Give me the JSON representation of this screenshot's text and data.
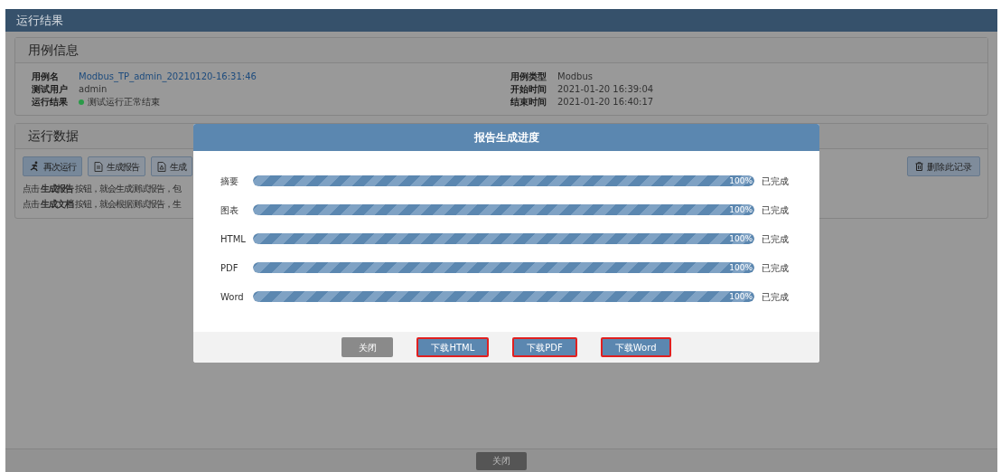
{
  "page_title": "运行结果",
  "case_info": {
    "title": "用例信息",
    "left_fields": [
      {
        "label": "用例名",
        "value": "Modbus_TP_admin_20210120-16:31:46",
        "kind": "link"
      },
      {
        "label": "测试用户",
        "value": "admin",
        "kind": "text"
      },
      {
        "label": "运行结果",
        "value": "测试运行正常结束",
        "kind": "status",
        "color": "#2a9a48"
      }
    ],
    "right_fields": [
      {
        "label": "用例类型",
        "value": "Modbus",
        "kind": "text"
      },
      {
        "label": "开始时间",
        "value": "2021-01-20 16:39:04",
        "kind": "text"
      },
      {
        "label": "结束时间",
        "value": "2021-01-20 16:40:17",
        "kind": "text"
      }
    ]
  },
  "run_data": {
    "title": "运行数据",
    "buttons": [
      {
        "label": "再次运行",
        "kind": "run"
      },
      {
        "label": "生成报告",
        "kind": "report"
      },
      {
        "label": "生成",
        "kind": "pdf"
      }
    ],
    "delete_button": "删除此记录",
    "hints": [
      "点击 **生成报告** 按钮，就会生成测试报告，包",
      "点击 **生成文档** 按钮，就会根据测试报告，生"
    ]
  },
  "footer_button": "关闭",
  "dialog": {
    "title": "报告生成进度",
    "rows": [
      {
        "label": "摘要",
        "level": 1,
        "reading": "100%",
        "status": "已完成"
      },
      {
        "label": "图表",
        "level": 1,
        "reading": "100%",
        "status": "已完成"
      },
      {
        "label": "HTML",
        "level": 1,
        "reading": "100%",
        "status": "已完成"
      },
      {
        "label": "PDF",
        "level": 1,
        "reading": "100%",
        "status": "已完成"
      },
      {
        "label": "Word",
        "level": 1,
        "reading": "100%",
        "status": "已完成"
      }
    ],
    "buttons": [
      {
        "label": "关闭",
        "kind": "secondary",
        "highlighted": false
      },
      {
        "label": "下载HTML",
        "kind": "primary",
        "highlighted": true
      },
      {
        "label": "下载PDF",
        "kind": "primary",
        "highlighted": true
      },
      {
        "label": "下载Word",
        "kind": "primary",
        "highlighted": true
      }
    ]
  }
}
